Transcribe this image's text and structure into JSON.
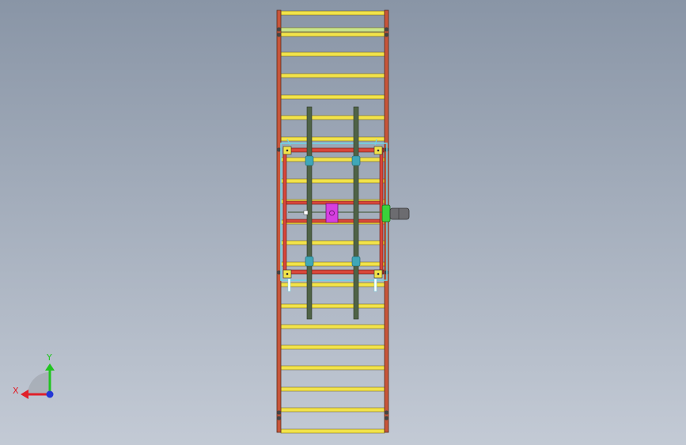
{
  "viewport": {
    "background_top": "#8995a6",
    "background_bottom": "#c3cad5"
  },
  "colors": {
    "frame_rail": "#c8553a",
    "rail_outline": "#5a2a1a",
    "roller": "#f2e34a",
    "roller_highlight": "#c9e58a",
    "roller_outline": "#6a5a10",
    "carriage_frame": "#d8463a",
    "carriage_inner": "#6fd3e6",
    "shaft": "#4f6347",
    "bearing": "#3fa7b8",
    "motor_mount": "#3ad23a",
    "motor": "#6c6c70",
    "cylinder_block": "#d63fe0",
    "bolt": "#444444"
  },
  "triad": {
    "x_label": "X",
    "y_label": "Y",
    "x_color": "#e0202a",
    "y_color": "#21c421",
    "z_color": "#2437d6"
  }
}
